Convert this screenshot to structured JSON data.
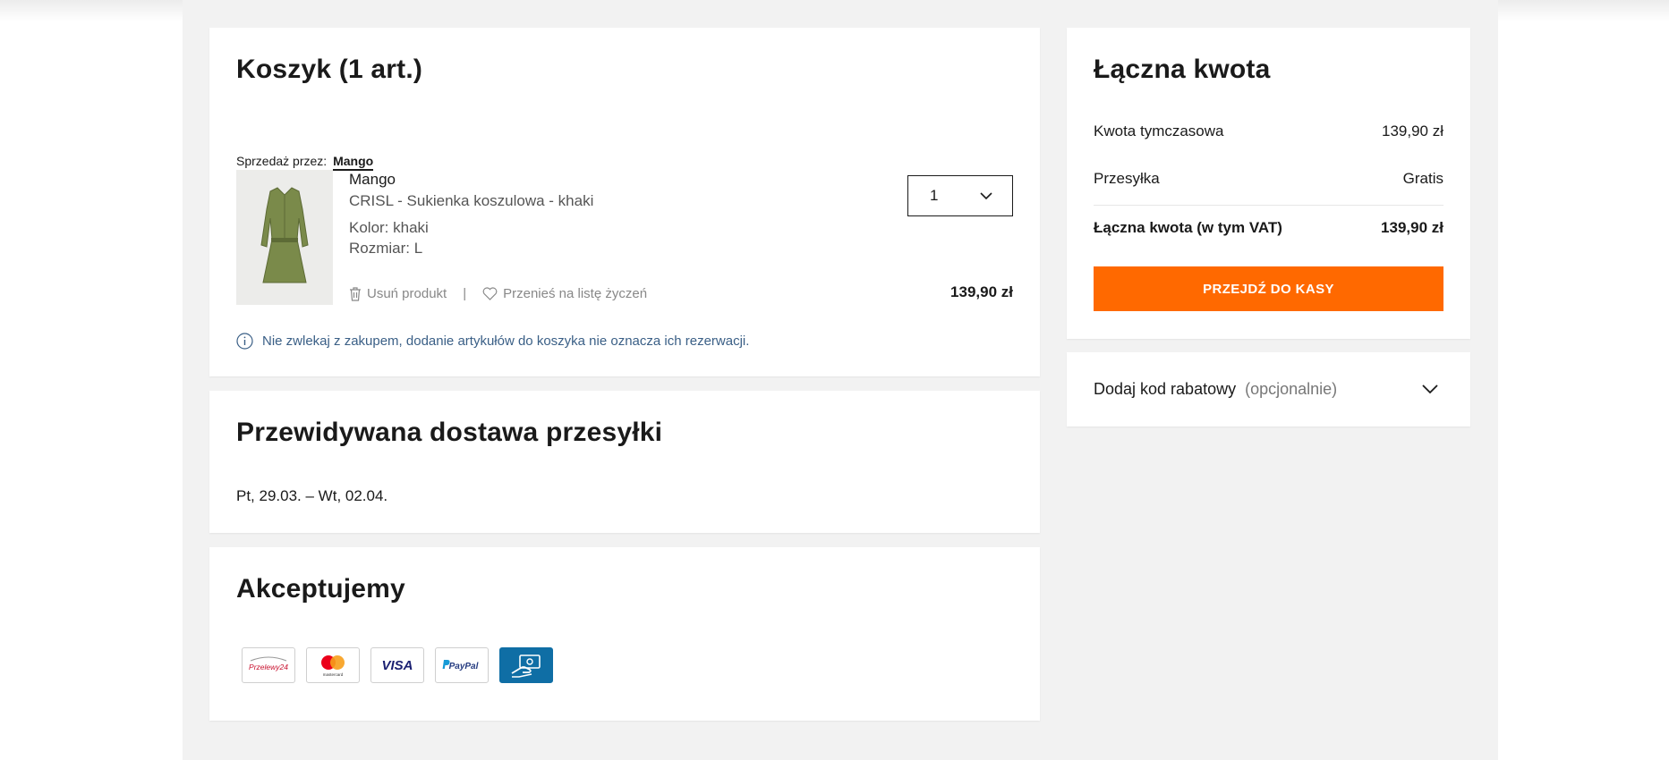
{
  "cart": {
    "title": "Koszyk (1 art.)",
    "seller_label": "Sprzedaż przez:",
    "seller_name": "Mango",
    "item": {
      "brand": "Mango",
      "name": "CRISL - Sukienka koszulowa - khaki",
      "color": "Kolor: khaki",
      "size": "Rozmiar: L",
      "quantity": "1",
      "price": "139,90 zł",
      "remove_label": "Usuń produkt",
      "separator": "|",
      "wishlist_label": "Przenieś na listę życzeń",
      "image_icon": "khaki-dress-image"
    },
    "notice": "Nie zwlekaj z zakupem, dodanie artykułów do koszyka nie oznacza ich rezerwacji."
  },
  "delivery": {
    "title": "Przewidywana dostawa przesyłki",
    "dates": "Pt, 29.03. – Wt, 02.04."
  },
  "payments": {
    "title": "Akceptujemy",
    "methods": [
      {
        "name": "Przelewy24",
        "label": "Przelewy24"
      },
      {
        "name": "Mastercard",
        "label": "mastercard"
      },
      {
        "name": "Visa",
        "label": "VISA"
      },
      {
        "name": "PayPal",
        "label": "PayPal"
      },
      {
        "name": "Cash",
        "label": ""
      }
    ]
  },
  "summary": {
    "title": "Łączna kwota",
    "subtotal_label": "Kwota tymczasowa",
    "subtotal_value": "139,90 zł",
    "shipping_label": "Przesyłka",
    "shipping_value": "Gratis",
    "total_label": "Łączna kwota (w tym VAT)",
    "total_value": "139,90 zł",
    "checkout_label": "PRZEJDŹ DO KASY"
  },
  "discount": {
    "label": "Dodaj kod rabatowy",
    "optional": "(opcjonalnie)"
  },
  "colors": {
    "accent": "#ff6900",
    "notice": "#3a5f86",
    "background": "#f2f2f2"
  }
}
